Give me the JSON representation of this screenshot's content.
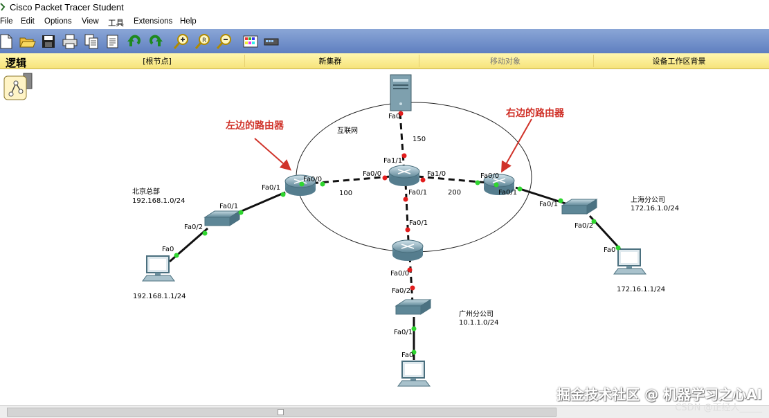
{
  "window": {
    "title": "Cisco Packet Tracer Student"
  },
  "menu": [
    "File",
    "Edit",
    "Options",
    "View",
    "工具",
    "Extensions",
    "Help"
  ],
  "toolbar": [
    "new-icon",
    "open-icon",
    "save-icon",
    "print-icon",
    "copy-icon",
    "paste-icon",
    "undo-icon",
    "redo-icon",
    "zoom-in-icon",
    "zoom-reset-icon",
    "zoom-out-icon",
    "palette-icon",
    "device-icon"
  ],
  "workspace_bar": {
    "mode": "逻辑",
    "root": "[根节点]",
    "new_cluster": "新集群",
    "move_object": "移动对象",
    "background": "设备工作区背景"
  },
  "annotations": {
    "left_router": "左边的路由器",
    "right_router": "右边的路由器"
  },
  "internet": {
    "label": "互联网"
  },
  "ports": {
    "server_fa0": "Fa0",
    "core_fa11": "Fa1/1",
    "core_fa00": "Fa0/0",
    "core_fa10": "Fa1/0",
    "core_fa01": "Fa0/1",
    "left_fa00": "Fa0/0",
    "left_fa01": "Fa0/1",
    "right_fa00": "Fa0/0",
    "right_fa01": "Fa0/1",
    "bottom_fa01": "Fa0/1",
    "bottom_fa00": "Fa0/0",
    "sw_gz_fa02": "Fa0/2",
    "sw_gz_fa01": "Fa0/1",
    "pc_gz_fa0": "Fa0",
    "sw_bj_fa01": "Fa0/1",
    "sw_bj_fa02": "Fa0/2",
    "pc_bj_fa0": "Fa0",
    "sw_sh_fa01": "Fa0/1",
    "sw_sh_fa02": "Fa0/2",
    "pc_sh_fa0": "Fa0"
  },
  "link_costs": {
    "server": "150",
    "left": "100",
    "right": "200"
  },
  "sites": {
    "beijing": {
      "name": "北京总部",
      "net": "192.168.1.0/24",
      "pc_ip": "192.168.1.1/24"
    },
    "shanghai": {
      "name": "上海分公司",
      "net": "172.16.1.0/24",
      "pc_ip": "172.16.1.1/24"
    },
    "guangzhou": {
      "name": "广州分公司",
      "net": "10.1.1.0/24"
    }
  },
  "watermark": {
    "line1": "掘金技术社区 @ 机器学习之心AI",
    "line2": "CSDN @正经人_____"
  }
}
